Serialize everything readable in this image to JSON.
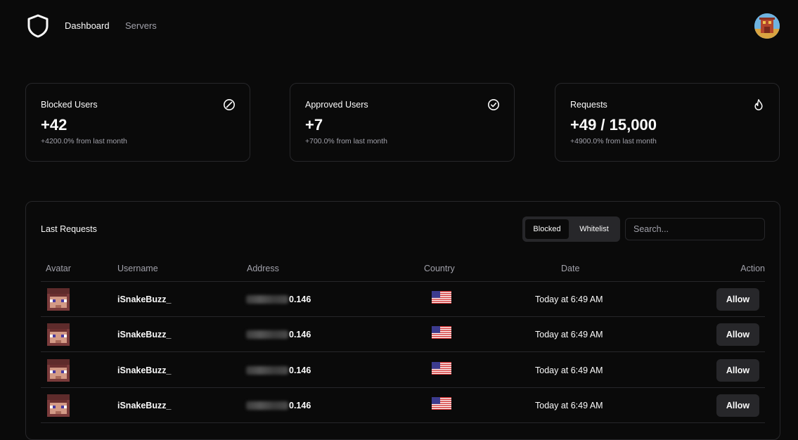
{
  "nav": {
    "dashboard": "Dashboard",
    "servers": "Servers"
  },
  "colors": {
    "background": "#0a0a0a",
    "border": "#27272a",
    "muted_text": "#a1a1aa",
    "text": "#fafafa"
  },
  "cards": [
    {
      "title": "Blocked Users",
      "value": "+42",
      "sub": "+4200.0% from last month",
      "icon": "circle-slash-icon"
    },
    {
      "title": "Approved Users",
      "value": "+7",
      "sub": "+700.0% from last month",
      "icon": "circle-check-icon"
    },
    {
      "title": "Requests",
      "value": "+49 / 15,000",
      "sub": "+4900.0% from last month",
      "icon": "flame-icon"
    }
  ],
  "panel": {
    "title": "Last Requests",
    "toggle": {
      "blocked": "Blocked",
      "whitelist": "Whitelist",
      "selected": "Blocked"
    },
    "search_placeholder": "Search...",
    "search_value": "",
    "columns": {
      "avatar": "Avatar",
      "username": "Username",
      "address": "Address",
      "country": "Country",
      "date": "Date",
      "action": "Action"
    },
    "rows": [
      {
        "username": "iSnakeBuzz_",
        "address": "0.146",
        "country": "us-flag-icon",
        "date": "Today at 6:49 AM",
        "action": "Allow"
      },
      {
        "username": "iSnakeBuzz_",
        "address": "0.146",
        "country": "us-flag-icon",
        "date": "Today at 6:49 AM",
        "action": "Allow"
      },
      {
        "username": "iSnakeBuzz_",
        "address": "0.146",
        "country": "us-flag-icon",
        "date": "Today at 6:49 AM",
        "action": "Allow"
      },
      {
        "username": "iSnakeBuzz_",
        "address": "0.146",
        "country": "us-flag-icon",
        "date": "Today at 6:49 AM",
        "action": "Allow"
      }
    ]
  }
}
